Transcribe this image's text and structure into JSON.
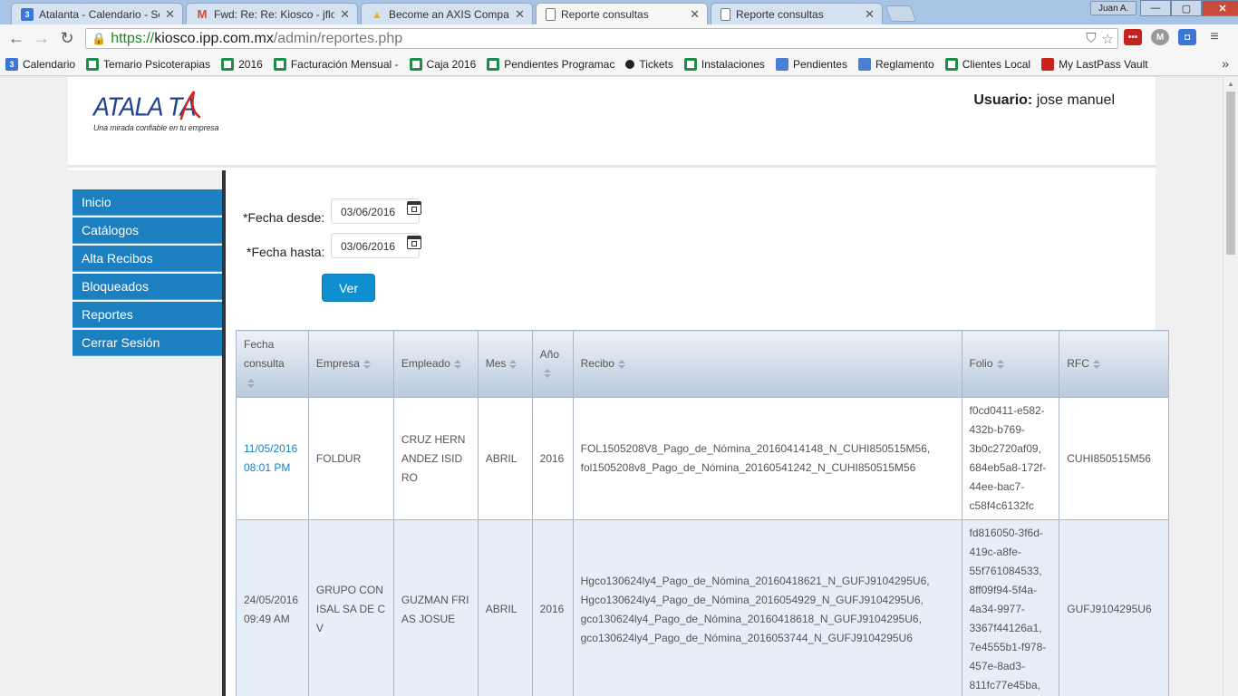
{
  "browser": {
    "tabs": [
      {
        "title": "Atalanta - Calendario - Se",
        "icon": "calendar-icon",
        "icon_text": "3",
        "icon_color": "#3b76d6"
      },
      {
        "title": "Fwd: Re: Re: Kiosco - jflore",
        "icon": "gmail-icon",
        "icon_text": "M",
        "icon_color": "#d44638"
      },
      {
        "title": "Become an AXIS Compani",
        "icon": "axis-icon",
        "icon_text": "▲",
        "icon_color": "#f3b01b"
      },
      {
        "title": "Reporte consultas",
        "icon": "page-icon",
        "icon_text": "",
        "icon_color": "#ffffff"
      },
      {
        "title": "Reporte consultas",
        "icon": "page-icon",
        "icon_text": "",
        "icon_color": "#ffffff"
      }
    ],
    "active_tab": 3,
    "user": "Juan A.",
    "window_buttons": {
      "minimize": "—",
      "maximize": "▢",
      "close": "✕"
    },
    "nav": {
      "back": "←",
      "forward": "→",
      "reload": "↻"
    },
    "url": {
      "scheme": "https://",
      "host": "kiosco.ipp.com.mx",
      "path": "/admin/reportes.php"
    },
    "extensions": [
      {
        "name": "lastpass-extension-icon",
        "text": "•••",
        "color": "#c6231f"
      },
      {
        "name": "mega-extension-icon",
        "text": "M",
        "color": "#9a9a9a"
      },
      {
        "name": "cast-extension-icon",
        "text": "◘",
        "color": "#3b76d6"
      },
      {
        "name": "menu-icon",
        "text": "≡",
        "color": "#555555"
      }
    ],
    "bookmarks": [
      {
        "label": "Calendario",
        "type": "cal"
      },
      {
        "label": "Temario Psicoterapias",
        "type": "sheet"
      },
      {
        "label": "2016",
        "type": "sheet"
      },
      {
        "label": "Facturación Mensual -",
        "type": "sheet"
      },
      {
        "label": "Caja 2016",
        "type": "sheet"
      },
      {
        "label": "Pendientes Programac",
        "type": "sheet"
      },
      {
        "label": "Tickets",
        "type": "dot"
      },
      {
        "label": "Instalaciones",
        "type": "sheet"
      },
      {
        "label": "Pendientes",
        "type": "doc"
      },
      {
        "label": "Reglamento",
        "type": "doc"
      },
      {
        "label": "Clientes Local",
        "type": "sheet"
      },
      {
        "label": "My LastPass Vault",
        "type": "lp"
      }
    ],
    "bookmarks_more": "»"
  },
  "header": {
    "logo_word": "ATALA TA",
    "logo_tagline": "Una mirada confiable en tu empresa",
    "user_label": "Usuario:",
    "user_name": "jose manuel"
  },
  "sidebar": {
    "items": [
      {
        "label": "Inicio"
      },
      {
        "label": "Catálogos"
      },
      {
        "label": "Alta Recibos"
      },
      {
        "label": "Bloqueados"
      },
      {
        "label": "Reportes"
      },
      {
        "label": "Cerrar Sesión"
      }
    ]
  },
  "form": {
    "fecha_desde_label": "*Fecha desde:",
    "fecha_desde_value": "03/06/2016",
    "fecha_hasta_label": "*Fecha hasta:",
    "fecha_hasta_value": "03/06/2016",
    "ver_label": "Ver"
  },
  "table": {
    "columns": [
      "Fecha consulta",
      "Empresa",
      "Empleado",
      "Mes",
      "Año",
      "Recibo",
      "Folio",
      "RFC"
    ],
    "rows": [
      {
        "fecha": "11/05/2016 08:01 PM",
        "empresa": "FOLDUR",
        "empleado": "CRUZ HERNANDEZ ISIDRO",
        "mes": "ABRIL",
        "anio": "2016",
        "recibo": "FOL1505208V8_Pago_de_Nómina_20160414148_N_CUHI850515M56, fol1505208v8_Pago_de_Nómina_20160541242_N_CUHI850515M56",
        "folio": "f0cd0411-e582-432b-b769-3b0c2720af09, 684eb5a8-172f-44ee-bac7-c58f4c6132fc",
        "rfc": "CUHI850515M56"
      },
      {
        "fecha": "24/05/2016 09:49 AM",
        "empresa": "GRUPO CONISAL SA DE CV",
        "empleado": "GUZMAN FRIAS JOSUE",
        "mes": "ABRIL",
        "anio": "2016",
        "recibo": "Hgco130624ly4_Pago_de_Nómina_20160418621_N_GUFJ9104295U6, Hgco130624ly4_Pago_de_Nómina_2016054929_N_GUFJ9104295U6, gco130624ly4_Pago_de_Nómina_20160418618_N_GUFJ9104295U6, gco130624ly4_Pago_de_Nómina_2016053744_N_GUFJ9104295U6",
        "folio": "fd816050-3f6d-419c-a8fe-55f761084533, 8ff09f94-5f4a-4a34-9977-3367f44126a1, 7e4555b1-f978-457e-8ad3-811fc77e45ba,",
        "rfc": "GUFJ9104295U6"
      }
    ]
  }
}
